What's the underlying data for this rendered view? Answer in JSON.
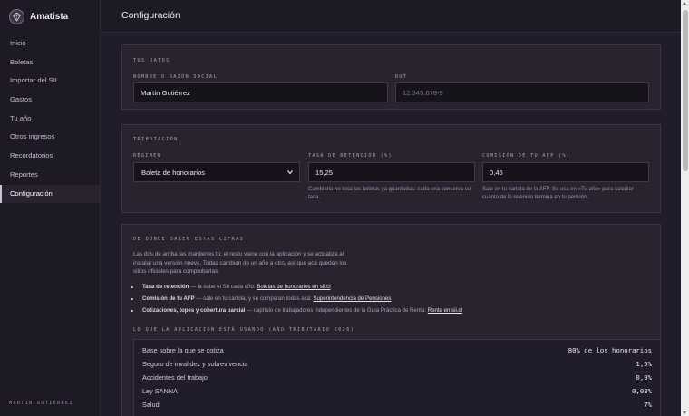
{
  "app": {
    "name": "Amatista",
    "logo": "amethyst-gem-icon"
  },
  "sidebar": {
    "items": [
      {
        "label": "Inicio"
      },
      {
        "label": "Boletas"
      },
      {
        "label": "Importar del SII"
      },
      {
        "label": "Gastos"
      },
      {
        "label": "Tu año"
      },
      {
        "label": "Otros ingresos"
      },
      {
        "label": "Recordatorios"
      },
      {
        "label": "Reportes"
      },
      {
        "label": "Configuración",
        "active": true
      }
    ],
    "user": "Martín Gutiérrez"
  },
  "header": {
    "title": "Configuración"
  },
  "datos": {
    "title": "Tus datos",
    "name_label": "Nombre o razón social",
    "name_value": "Martín Gutiérrez",
    "rut_label": "RUT",
    "rut_placeholder": "12.345.678-9"
  },
  "tributacion": {
    "title": "Tributación",
    "regimen_label": "Régimen",
    "regimen_value": "Boleta de honorarios",
    "retencion_label": "Tasa de retención (%)",
    "retencion_value": "15,25",
    "retencion_help": "Cambiarla no toca las boletas ya guardadas: cada una conserva su tasa.",
    "afp_label": "Comisión de tu AFP (%)",
    "afp_value": "0,46",
    "afp_help": "Sale en tu cartola de la AFP. Se usa en «Tu año» para calcular cuánto de lo retenido termina en tu pensión."
  },
  "fuentes": {
    "title": "De dónde salen estas cifras",
    "intro": "Las dos de arriba las mantienes tú; el resto viene con la aplicación y se actualiza al instalar una versión nueva. Todas cambian de un año a otro, así que acá quedan los sitios oficiales para comprobarlas.",
    "items": [
      {
        "strong": "Tasa de retención",
        "text": " — la sube el SII cada año. ",
        "link": "Boletas de honorarios en sii.cl"
      },
      {
        "strong": "Comisión de tu AFP",
        "text": " — sale en tu cartola, y se comparan todas acá: ",
        "link": "Superintendencia de Pensiones"
      },
      {
        "strong": "Cotizaciones, topes y cobertura parcial",
        "text": " — capítulo de trabajadores independientes de la Guía Práctica de Renta: ",
        "link": "Renta en sii.cl"
      }
    ],
    "rates_title": "Lo que la aplicación está usando (año tributario 2026)",
    "rates": [
      {
        "label": "Base sobre la que se cotiza",
        "value": "80% de los honorarios"
      },
      {
        "label": "Seguro de invalidez y sobrevivencia",
        "value": "1,5%"
      },
      {
        "label": "Accidentes del trabajo",
        "value": "0,9%"
      },
      {
        "label": "Ley SANNA",
        "value": "0,03%"
      },
      {
        "label": "Salud",
        "value": "7%"
      }
    ]
  }
}
